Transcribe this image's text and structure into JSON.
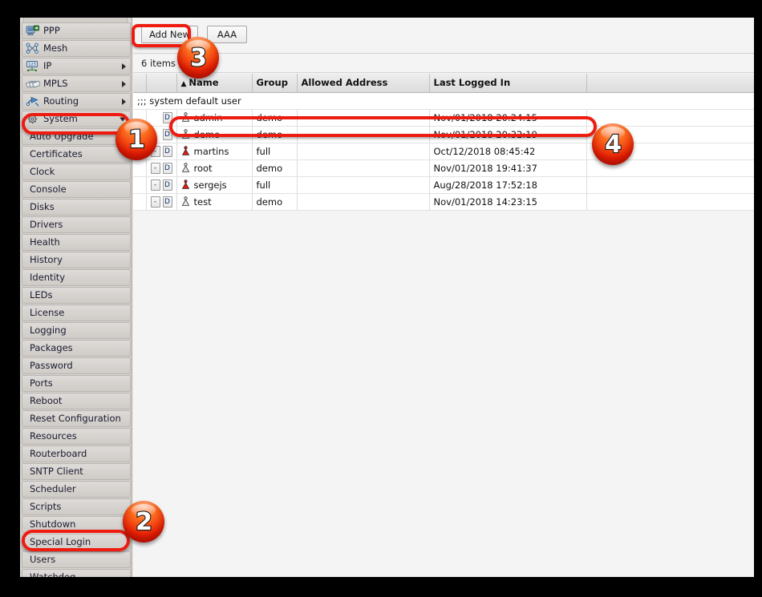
{
  "sidebar": {
    "items": [
      {
        "label": "PPP",
        "icon": "ppp-icon",
        "arrow": "none",
        "sub": false
      },
      {
        "label": "Mesh",
        "icon": "mesh-icon",
        "arrow": "none",
        "sub": false
      },
      {
        "label": "IP",
        "icon": "ip-icon",
        "arrow": "right",
        "sub": false
      },
      {
        "label": "MPLS",
        "icon": "mpls-icon",
        "arrow": "right",
        "sub": false
      },
      {
        "label": "Routing",
        "icon": "routing-icon",
        "arrow": "right",
        "sub": false
      },
      {
        "label": "System",
        "icon": "system-gear-icon",
        "arrow": "down",
        "sub": false
      },
      {
        "label": "Auto Upgrade",
        "icon": "none",
        "arrow": "none",
        "sub": true
      },
      {
        "label": "Certificates",
        "icon": "none",
        "arrow": "none",
        "sub": true
      },
      {
        "label": "Clock",
        "icon": "none",
        "arrow": "none",
        "sub": true
      },
      {
        "label": "Console",
        "icon": "none",
        "arrow": "none",
        "sub": true
      },
      {
        "label": "Disks",
        "icon": "none",
        "arrow": "none",
        "sub": true
      },
      {
        "label": "Drivers",
        "icon": "none",
        "arrow": "none",
        "sub": true
      },
      {
        "label": "Health",
        "icon": "none",
        "arrow": "none",
        "sub": true
      },
      {
        "label": "History",
        "icon": "none",
        "arrow": "none",
        "sub": true
      },
      {
        "label": "Identity",
        "icon": "none",
        "arrow": "none",
        "sub": true
      },
      {
        "label": "LEDs",
        "icon": "none",
        "arrow": "none",
        "sub": true
      },
      {
        "label": "License",
        "icon": "none",
        "arrow": "none",
        "sub": true
      },
      {
        "label": "Logging",
        "icon": "none",
        "arrow": "none",
        "sub": true
      },
      {
        "label": "Packages",
        "icon": "none",
        "arrow": "none",
        "sub": true
      },
      {
        "label": "Password",
        "icon": "none",
        "arrow": "none",
        "sub": true
      },
      {
        "label": "Ports",
        "icon": "none",
        "arrow": "none",
        "sub": true
      },
      {
        "label": "Reboot",
        "icon": "none",
        "arrow": "none",
        "sub": true
      },
      {
        "label": "Reset Configuration",
        "icon": "none",
        "arrow": "none",
        "sub": true
      },
      {
        "label": "Resources",
        "icon": "none",
        "arrow": "none",
        "sub": true
      },
      {
        "label": "Routerboard",
        "icon": "none",
        "arrow": "none",
        "sub": true
      },
      {
        "label": "SNTP Client",
        "icon": "none",
        "arrow": "none",
        "sub": true
      },
      {
        "label": "Scheduler",
        "icon": "none",
        "arrow": "none",
        "sub": true
      },
      {
        "label": "Scripts",
        "icon": "none",
        "arrow": "none",
        "sub": true
      },
      {
        "label": "Shutdown",
        "icon": "none",
        "arrow": "none",
        "sub": true
      },
      {
        "label": "Special Login",
        "icon": "none",
        "arrow": "none",
        "sub": true
      },
      {
        "label": "Users",
        "icon": "none",
        "arrow": "none",
        "sub": true
      },
      {
        "label": "Watchdog",
        "icon": "none",
        "arrow": "none",
        "sub": true
      }
    ]
  },
  "toolbar": {
    "add_new_label": "Add New",
    "aaa_label": "AAA"
  },
  "status": {
    "item_count": "6 items"
  },
  "table": {
    "columns": [
      "",
      "",
      "Name",
      "Group",
      "Allowed Address",
      "Last Logged In",
      ""
    ],
    "sort_caret": "▲",
    "comment_row": ";;; system default user",
    "rows": [
      {
        "minus": "",
        "d": "D",
        "icon": "user-icon-gray",
        "name": "admin",
        "group": "demo",
        "allowed_address": "",
        "last_logged_in": "Nov/01/2018 20:24:15"
      },
      {
        "minus": "",
        "d": "D",
        "icon": "user-icon-gray",
        "name": "demo",
        "group": "demo",
        "allowed_address": "",
        "last_logged_in": "Nov/01/2018 20:32:19"
      },
      {
        "minus": "-",
        "d": "D",
        "icon": "user-icon-red",
        "name": "martins",
        "group": "full",
        "allowed_address": "",
        "last_logged_in": "Oct/12/2018 08:45:42"
      },
      {
        "minus": "-",
        "d": "D",
        "icon": "user-icon-gray",
        "name": "root",
        "group": "demo",
        "allowed_address": "",
        "last_logged_in": "Nov/01/2018 19:41:37"
      },
      {
        "minus": "-",
        "d": "D",
        "icon": "user-icon-red",
        "name": "sergejs",
        "group": "full",
        "allowed_address": "",
        "last_logged_in": "Aug/28/2018 17:52:18"
      },
      {
        "minus": "-",
        "d": "D",
        "icon": "user-icon-gray",
        "name": "test",
        "group": "demo",
        "allowed_address": "",
        "last_logged_in": "Nov/01/2018 14:23:15"
      }
    ]
  },
  "annotations": {
    "accent_color": "#ee1b11",
    "badges": [
      {
        "number": "1",
        "target": "system-menu-item"
      },
      {
        "number": "2",
        "target": "users-menu-item"
      },
      {
        "number": "3",
        "target": "add-new-button"
      },
      {
        "number": "4",
        "target": "admin-user-row"
      }
    ]
  }
}
